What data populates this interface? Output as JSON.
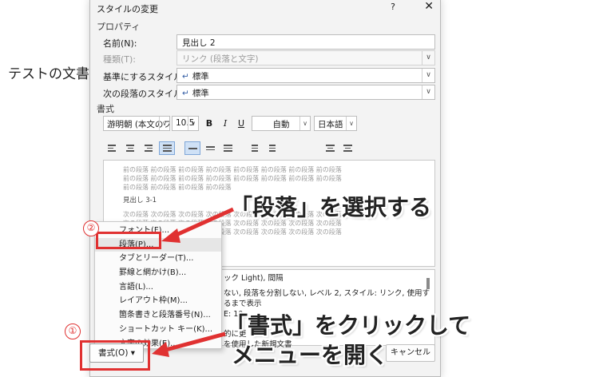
{
  "document": {
    "text": "テストの文書"
  },
  "dialog": {
    "title": "スタイルの変更",
    "help_label": "?",
    "close_label": "✕",
    "properties_label": "プロパティ",
    "name_label": "名前(N):",
    "name_value": "見出し 2",
    "type_label": "種類(T):",
    "type_value": "リンク (段落と文字)",
    "based_on_label": "基準にするスタイル(B):",
    "based_on_value": "標準",
    "next_style_label": "次の段落のスタイル(S):",
    "next_style_value": "標準",
    "formatting_label": "書式",
    "font_name": "游明朝 (本文のフ",
    "font_size": "10.5",
    "bold": "B",
    "italic": "I",
    "underline": "U",
    "color_value": "自動",
    "language_value": "日本語",
    "preview_prev": [
      "前の段落 前の段落 前の段落 前の段落 前の段落 前の段落 前の段落 前の段落",
      "前の段落 前の段落 前の段落 前の段落 前の段落 前の段落 前の段落 前の段落",
      "前の段落 前の段落 前の段落 前の段落"
    ],
    "preview_sample": "見出し 3-1",
    "preview_next": [
      "次の段落 次の段落 次の段落 次の段落 次の段落 次の段落 次の段落 次の段落",
      "次の段落 次の段落 次の段落 次の段落 次の段落 次の段落 次の段落 次の段落",
      "次の段落 次の段落 次の段落 次の段落 次の段落 次の段落 次の段落 次の段落"
    ],
    "desc_lines": [
      "ック Light), 間隔",
      "",
      "ない, 段落を分割しない, レベル 2, スタイル: リンク, 使用するまで表示",
      "E: 10",
      "",
      "的に更",
      "を使用した新規文書"
    ],
    "cancel_label": "キャンセル",
    "format_button_label": "書式(O) ▾"
  },
  "format_menu": {
    "items": [
      "フォント(F)...",
      "段落(P)...",
      "タブとリーダー(T)...",
      "罫線と網かけ(B)...",
      "言語(L)...",
      "レイアウト枠(M)...",
      "箇条書きと段落番号(N)...",
      "ショートカット キー(K)...",
      "文字の効果(E)..."
    ]
  },
  "annotations": {
    "step1": "①",
    "step2": "②",
    "callout_paragraph": "「段落」を選択する",
    "callout_format_line1": "「書式」をクリックして",
    "callout_format_line2": "メニューを開く",
    "color": "#e03131"
  }
}
